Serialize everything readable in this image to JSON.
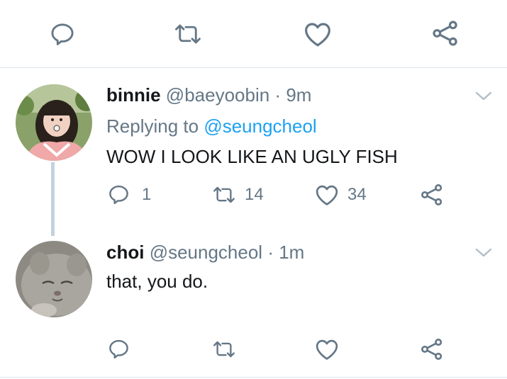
{
  "top_actions": {
    "reply_count": "",
    "retweet_count": "",
    "like_count": ""
  },
  "tweets": [
    {
      "display_name": "binnie",
      "handle": "@baeyoobin",
      "separator": "·",
      "time": "9m",
      "replying_to_label": "Replying to",
      "replying_to_handle": "@seungcheol",
      "text": "WOW I LOOK LIKE AN UGLY FISH",
      "reply_count": "1",
      "retweet_count": "14",
      "like_count": "34"
    },
    {
      "display_name": "choi",
      "handle": "@seungcheol",
      "separator": "·",
      "time": "1m",
      "text": "that, you do.",
      "reply_count": "",
      "retweet_count": "",
      "like_count": ""
    }
  ],
  "colors": {
    "icon_gray": "#657786",
    "link_blue": "#1da1f2",
    "thread_line": "#c4d2dc",
    "divider": "#dde3e8"
  },
  "icons": [
    "reply-icon",
    "retweet-icon",
    "like-icon",
    "share-icon",
    "chevron-down-icon"
  ]
}
